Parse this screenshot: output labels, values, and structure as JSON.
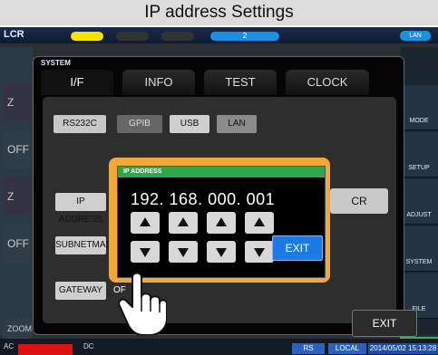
{
  "caption": "IP address Settings",
  "topbar": {
    "left_label": "LCR",
    "center_label": "2",
    "right_badge": "LAN"
  },
  "system": {
    "title": "SYSTEM",
    "tabs": [
      {
        "label": "I/F",
        "active": true
      },
      {
        "label": "INFO",
        "active": false
      },
      {
        "label": "TEST",
        "active": false
      },
      {
        "label": "CLOCK",
        "active": false
      }
    ],
    "interfaces": {
      "rs232c": "RS232C",
      "gpib": "GPIB",
      "usb": "USB",
      "lan": "LAN"
    },
    "ip_address_label": "IP ADDRESS",
    "subnet_mask_label": "SUBNETMASK",
    "gateway_label": "GATEWAY",
    "gateway_state": "OF",
    "cr_button": "CR",
    "exit_button": "EXIT"
  },
  "ip_dialog": {
    "title": "IP ADDRESS",
    "value": "192. 168. 000. 001",
    "exit_label": "EXIT",
    "up_arrow_icon": "arrow-up-icon",
    "down_arrow_icon": "arrow-down-icon",
    "pointer_icon": "hand-pointer-icon"
  },
  "right_sidebar": [
    {
      "label": "MODE"
    },
    {
      "label": "SETUP"
    },
    {
      "label": "ADJUST"
    },
    {
      "label": "SYSTEM"
    },
    {
      "label": "FILE"
    }
  ],
  "bottom_status": {
    "dc": "DC",
    "left": "AC",
    "rs": "RS",
    "local": "LOCAL",
    "datetime": "2014/05/02 15:13:28"
  },
  "left_column": [
    "Z",
    "OFF",
    "Z",
    "OFF",
    "ZOOM"
  ]
}
